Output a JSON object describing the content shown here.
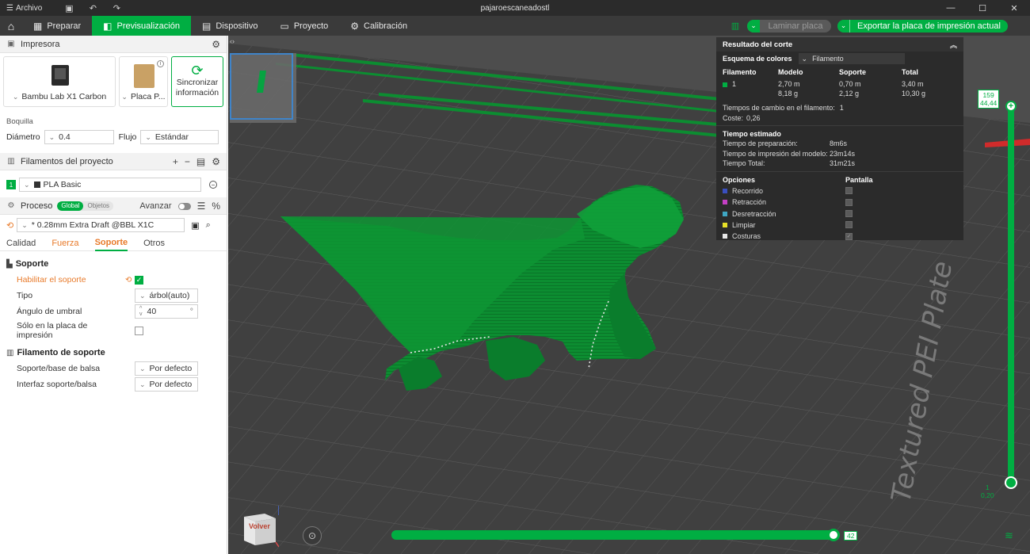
{
  "titlebar": {
    "menu_label": "Archivo",
    "title": "pajaroescaneadostl"
  },
  "topbar": {
    "tabs": [
      {
        "label": "Preparar",
        "icon": "prepare-icon"
      },
      {
        "label": "Previsualización",
        "icon": "preview-icon",
        "active": true
      },
      {
        "label": "Dispositivo",
        "icon": "device-icon"
      },
      {
        "label": "Proyecto",
        "icon": "project-icon"
      },
      {
        "label": "Calibración",
        "icon": "calibration-icon"
      }
    ],
    "slice_label": "Laminar placa",
    "export_label": "Exportar la placa de impresión actual"
  },
  "sidebar": {
    "printer": {
      "title": "Impresora",
      "printer_name": "Bambu Lab X1 Carbon",
      "plate_name": "Placa P...",
      "sync_label": "Sincronizar información"
    },
    "nozzle": {
      "title": "Boquilla",
      "diameter_label": "Diámetro",
      "diameter_value": "0.4",
      "flow_label": "Flujo",
      "flow_value": "Estándar"
    },
    "filaments": {
      "title": "Filamentos del proyecto",
      "items": [
        {
          "num": "1",
          "name": "PLA Basic"
        }
      ]
    },
    "process": {
      "title": "Proceso",
      "toggle_global": "Global",
      "toggle_objects": "Objetos",
      "advanced_label": "Avanzar",
      "preset": "* 0.28mm Extra Draft @BBL X1C",
      "tabs": [
        "Calidad",
        "Fuerza",
        "Soporte",
        "Otros"
      ],
      "active_tab": "Soporte"
    },
    "support": {
      "group_title": "Soporte",
      "enable_label": "Habilitar el soporte",
      "type_label": "Tipo",
      "type_value": "árbol(auto)",
      "threshold_label": "Ángulo de umbral",
      "threshold_value": "40",
      "threshold_unit": "°",
      "plate_only_label": "Sólo en la placa de impresión",
      "filament_group_title": "Filamento de soporte",
      "base_label": "Soporte/base de balsa",
      "base_value": "Por defecto",
      "interface_label": "Interfaz soporte/balsa",
      "interface_value": "Por defecto"
    }
  },
  "result": {
    "title": "Resultado del corte",
    "scheme_label": "Esquema de colores",
    "scheme_value": "Filamento",
    "headers": [
      "Filamento",
      "Modelo",
      "Soporte",
      "Total"
    ],
    "row": {
      "filament": "1",
      "model_len": "2,70 m",
      "model_wt": "8,18 g",
      "support_len": "0,70 m",
      "support_wt": "2,12 g",
      "total_len": "3,40 m",
      "total_wt": "10,30 g"
    },
    "change_label": "Tiempos de cambio en el filamento:",
    "change_value": "1",
    "cost_label": "Coste:",
    "cost_value": "0,26",
    "time_title": "Tiempo estimado",
    "prep_label": "Tiempo de preparación:",
    "prep_value": "8m6s",
    "print_label": "Tiempo de impresión del modelo:",
    "print_value": "23m14s",
    "total_label": "Tiempo Total:",
    "total_value": "31m21s",
    "options_title": "Opciones",
    "display_title": "Pantalla",
    "options": [
      {
        "label": "Recorrido",
        "color": "#3a4fbf"
      },
      {
        "label": "Retracción",
        "color": "#c43fc4"
      },
      {
        "label": "Desretracción",
        "color": "#3fa7c4"
      },
      {
        "label": "Limpiar",
        "color": "#e6e028"
      },
      {
        "label": "Costuras",
        "color": "#e8e8e8"
      }
    ]
  },
  "slider": {
    "top_layer": "159",
    "top_height": "44,44",
    "bottom_layer": "1",
    "bottom_height": "0,20",
    "h_value": "42"
  },
  "viewport": {
    "plate_text": "Textured PEI Plate",
    "cube_label": "Volver"
  },
  "colors": {
    "accent": "#00ae42",
    "orange": "#e87a2a",
    "model_green": "#0a8a2e"
  }
}
